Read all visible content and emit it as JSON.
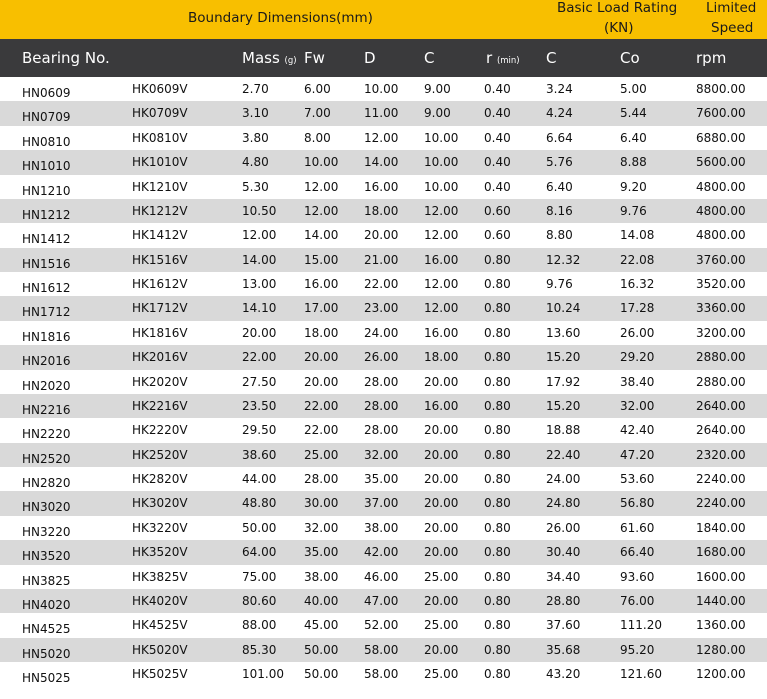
{
  "group_headers": {
    "boundary": "Boundary Dimensions(mm)",
    "load_line1": "Basic Load Rating",
    "load_line2": "(KN)",
    "speed_line1": "Limited",
    "speed_line2": "Speed"
  },
  "columns": [
    {
      "label": "Bearing No.",
      "unit": ""
    },
    {
      "label": "",
      "unit": ""
    },
    {
      "label": "Mass",
      "unit": "(g)"
    },
    {
      "label": "Fw",
      "unit": ""
    },
    {
      "label": "D",
      "unit": ""
    },
    {
      "label": "C",
      "unit": ""
    },
    {
      "label": "r",
      "unit": "(min)"
    },
    {
      "label": "C",
      "unit": ""
    },
    {
      "label": "Co",
      "unit": ""
    },
    {
      "label": "rpm",
      "unit": ""
    }
  ],
  "rows": [
    [
      "HN0609",
      "HK0609V",
      "2.70",
      "6.00",
      "10.00",
      "9.00",
      "0.40",
      "3.24",
      "5.00",
      "8800.00"
    ],
    [
      "HN0709",
      "HK0709V",
      "3.10",
      "7.00",
      "11.00",
      "9.00",
      "0.40",
      "4.24",
      "5.44",
      "7600.00"
    ],
    [
      "HN0810",
      "HK0810V",
      "3.80",
      "8.00",
      "12.00",
      "10.00",
      "0.40",
      "6.64",
      "6.40",
      "6880.00"
    ],
    [
      "HN1010",
      "HK1010V",
      "4.80",
      "10.00",
      "14.00",
      "10.00",
      "0.40",
      "5.76",
      "8.88",
      "5600.00"
    ],
    [
      "HN1210",
      "HK1210V",
      "5.30",
      "12.00",
      "16.00",
      "10.00",
      "0.40",
      "6.40",
      "9.20",
      "4800.00"
    ],
    [
      "HN1212",
      "HK1212V",
      "10.50",
      "12.00",
      "18.00",
      "12.00",
      "0.60",
      "8.16",
      "9.76",
      "4800.00"
    ],
    [
      "HN1412",
      "HK1412V",
      "12.00",
      "14.00",
      "20.00",
      "12.00",
      "0.60",
      "8.80",
      "14.08",
      "4800.00"
    ],
    [
      "HN1516",
      "HK1516V",
      "14.00",
      "15.00",
      "21.00",
      "16.00",
      "0.80",
      "12.32",
      "22.08",
      "3760.00"
    ],
    [
      "HN1612",
      "HK1612V",
      "13.00",
      "16.00",
      "22.00",
      "12.00",
      "0.80",
      "9.76",
      "16.32",
      "3520.00"
    ],
    [
      "HN1712",
      "HK1712V",
      "14.10",
      "17.00",
      "23.00",
      "12.00",
      "0.80",
      "10.24",
      "17.28",
      "3360.00"
    ],
    [
      "HN1816",
      "HK1816V",
      "20.00",
      "18.00",
      "24.00",
      "16.00",
      "0.80",
      "13.60",
      "26.00",
      "3200.00"
    ],
    [
      "HN2016",
      "HK2016V",
      "22.00",
      "20.00",
      "26.00",
      "18.00",
      "0.80",
      "15.20",
      "29.20",
      "2880.00"
    ],
    [
      "HN2020",
      "HK2020V",
      "27.50",
      "20.00",
      "28.00",
      "20.00",
      "0.80",
      "17.92",
      "38.40",
      "2880.00"
    ],
    [
      "HN2216",
      "HK2216V",
      "23.50",
      "22.00",
      "28.00",
      "16.00",
      "0.80",
      "15.20",
      "32.00",
      "2640.00"
    ],
    [
      "HN2220",
      "HK2220V",
      "29.50",
      "22.00",
      "28.00",
      "20.00",
      "0.80",
      "18.88",
      "42.40",
      "2640.00"
    ],
    [
      "HN2520",
      "HK2520V",
      "38.60",
      "25.00",
      "32.00",
      "20.00",
      "0.80",
      "22.40",
      "47.20",
      "2320.00"
    ],
    [
      "HN2820",
      "HK2820V",
      "44.00",
      "28.00",
      "35.00",
      "20.00",
      "0.80",
      "24.00",
      "53.60",
      "2240.00"
    ],
    [
      "HN3020",
      "HK3020V",
      "48.80",
      "30.00",
      "37.00",
      "20.00",
      "0.80",
      "24.80",
      "56.80",
      "2240.00"
    ],
    [
      "HN3220",
      "HK3220V",
      "50.00",
      "32.00",
      "38.00",
      "20.00",
      "0.80",
      "26.00",
      "61.60",
      "1840.00"
    ],
    [
      "HN3520",
      "HK3520V",
      "64.00",
      "35.00",
      "42.00",
      "20.00",
      "0.80",
      "30.40",
      "66.40",
      "1680.00"
    ],
    [
      "HN3825",
      "HK3825V",
      "75.00",
      "38.00",
      "46.00",
      "25.00",
      "0.80",
      "34.40",
      "93.60",
      "1600.00"
    ],
    [
      "HN4020",
      "HK4020V",
      "80.60",
      "40.00",
      "47.00",
      "20.00",
      "0.80",
      "28.80",
      "76.00",
      "1440.00"
    ],
    [
      "HN4525",
      "HK4525V",
      "88.00",
      "45.00",
      "52.00",
      "25.00",
      "0.80",
      "37.60",
      "111.20",
      "1360.00"
    ],
    [
      "HN5020",
      "HK5020V",
      "85.30",
      "50.00",
      "58.00",
      "20.00",
      "0.80",
      "35.68",
      "95.20",
      "1280.00"
    ],
    [
      "HN5025",
      "HK5025V",
      "101.00",
      "50.00",
      "58.00",
      "25.00",
      "0.80",
      "43.20",
      "121.60",
      "1200.00"
    ]
  ]
}
